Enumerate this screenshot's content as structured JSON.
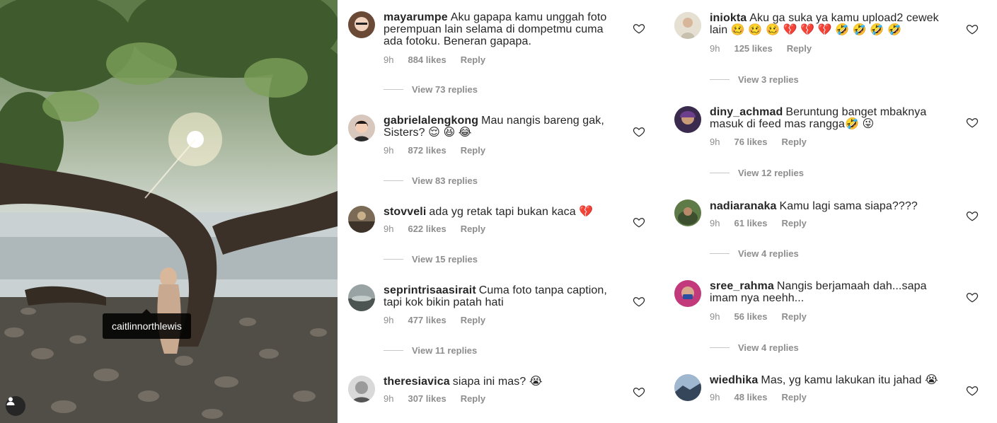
{
  "photo": {
    "tag": "caitlinnorthlewis"
  },
  "left_comments": [
    {
      "user": "mayarumpe",
      "text": "Aku gapapa kamu unggah foto perempuan lain selama di dompetmu cuma ada fotoku. Beneran gapapa.",
      "time": "9h",
      "likes": "884 likes",
      "reply": "Reply",
      "view_replies": "View 73 replies"
    },
    {
      "user": "gabrielalengkong",
      "text": "Mau nangis bareng gak, Sisters? 😌 😆 😂",
      "time": "9h",
      "likes": "872 likes",
      "reply": "Reply",
      "view_replies": "View 83 replies"
    },
    {
      "user": "stovveli",
      "text": "ada yg retak tapi bukan kaca 💔",
      "time": "9h",
      "likes": "622 likes",
      "reply": "Reply",
      "view_replies": "View 15 replies"
    },
    {
      "user": "seprintrisaasirait",
      "text": "Cuma foto tanpa caption, tapi kok bikin patah hati",
      "time": "9h",
      "likes": "477 likes",
      "reply": "Reply",
      "view_replies": "View 11 replies"
    },
    {
      "user": "theresiavica",
      "text": "siapa ini mas? 😭",
      "time": "9h",
      "likes": "307 likes",
      "reply": "Reply",
      "view_replies": ""
    }
  ],
  "right_comments": [
    {
      "user": "iniokta",
      "text": "Aku ga suka ya kamu upload2 cewek lain 🥴 🥴 🥴 💔 💔 💔  🤣 🤣 🤣 🤣",
      "time": "9h",
      "likes": "125 likes",
      "reply": "Reply",
      "view_replies": "View 3 replies"
    },
    {
      "user": "diny_achmad",
      "text": "Beruntung banget mbaknya masuk di feed mas rangga🤣 😜",
      "time": "9h",
      "likes": "76 likes",
      "reply": "Reply",
      "view_replies": "View 12 replies"
    },
    {
      "user": "nadiaranaka",
      "text": "Kamu lagi sama siapa????",
      "time": "9h",
      "likes": "61 likes",
      "reply": "Reply",
      "view_replies": "View 4 replies"
    },
    {
      "user": "sree_rahma",
      "text": "Nangis berjamaah dah...sapa imam nya neehh...",
      "time": "9h",
      "likes": "56 likes",
      "reply": "Reply",
      "view_replies": "View 4 replies"
    },
    {
      "user": "wiedhika",
      "text": "Mas, yg kamu lakukan itu jahad 😭",
      "time": "9h",
      "likes": "48 likes",
      "reply": "Reply",
      "view_replies": ""
    }
  ],
  "icons": {
    "heart": "heart-outline-icon",
    "user": "user-tag-icon"
  },
  "colors": {
    "text": "#262626",
    "muted": "#8e8e8e",
    "divider": "#c7c7c7"
  }
}
